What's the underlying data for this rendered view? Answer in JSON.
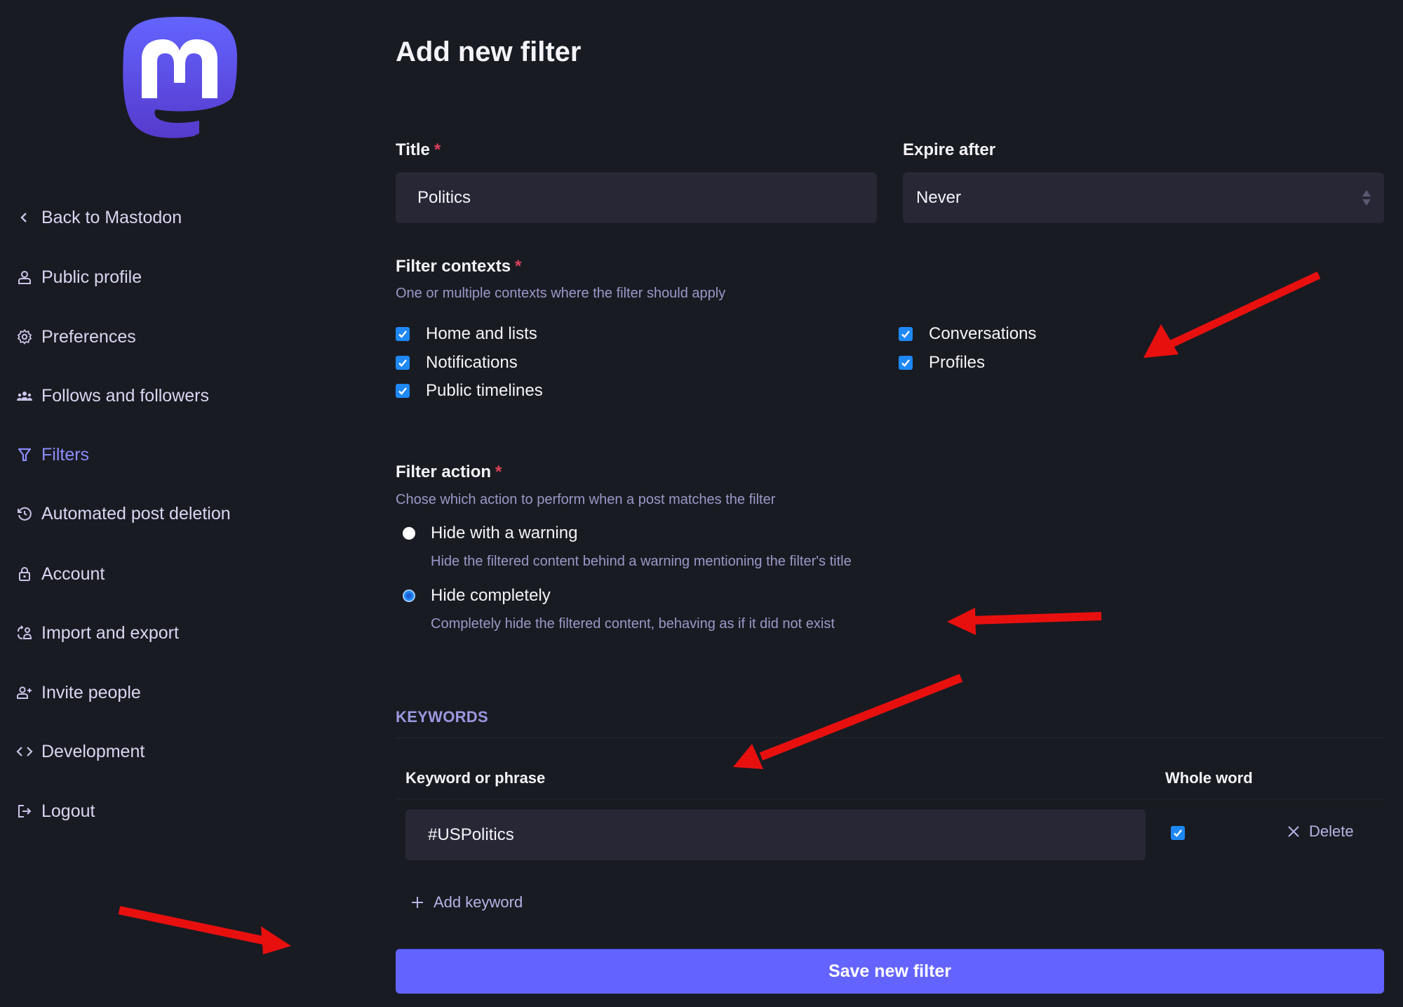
{
  "sidebar": {
    "logo": "mastodon-logo",
    "items": [
      {
        "label": "Back to Mastodon",
        "icon": "chevron-left-icon",
        "active": false
      },
      {
        "label": "Public profile",
        "icon": "user-icon",
        "active": false
      },
      {
        "label": "Preferences",
        "icon": "gear-icon",
        "active": false
      },
      {
        "label": "Follows and followers",
        "icon": "users-icon",
        "active": false
      },
      {
        "label": "Filters",
        "icon": "filter-icon",
        "active": true
      },
      {
        "label": "Automated post deletion",
        "icon": "history-icon",
        "active": false
      },
      {
        "label": "Account",
        "icon": "lock-icon",
        "active": false
      },
      {
        "label": "Import and export",
        "icon": "import-export-icon",
        "active": false
      },
      {
        "label": "Invite people",
        "icon": "user-plus-icon",
        "active": false
      },
      {
        "label": "Development",
        "icon": "code-icon",
        "active": false
      },
      {
        "label": "Logout",
        "icon": "logout-icon",
        "active": false
      }
    ]
  },
  "main": {
    "title": "Add new filter",
    "title_field": {
      "label": "Title",
      "required_mark": "*",
      "value": "Politics"
    },
    "expire_field": {
      "label": "Expire after",
      "value": "Never"
    },
    "contexts": {
      "label": "Filter contexts",
      "required_mark": "*",
      "hint": "One or multiple contexts where the filter should apply",
      "options": [
        {
          "label": "Home and lists",
          "checked": true
        },
        {
          "label": "Notifications",
          "checked": true
        },
        {
          "label": "Public timelines",
          "checked": true
        },
        {
          "label": "Conversations",
          "checked": true
        },
        {
          "label": "Profiles",
          "checked": true
        }
      ]
    },
    "action": {
      "label": "Filter action",
      "required_mark": "*",
      "hint": "Chose which action to perform when a post matches the filter",
      "options": [
        {
          "label": "Hide with a warning",
          "hint": "Hide the filtered content behind a warning mentioning the filter's title",
          "selected": false
        },
        {
          "label": "Hide completely",
          "hint": "Completely hide the filtered content, behaving as if it did not exist",
          "selected": true
        }
      ]
    },
    "keywords": {
      "heading": "KEYWORDS",
      "col_keyword": "Keyword or phrase",
      "col_whole_word": "Whole word",
      "rows": [
        {
          "keyword": "#USPolitics",
          "whole_word": true,
          "delete_label": "Delete"
        }
      ],
      "add_label": "Add keyword"
    },
    "save_label": "Save new filter"
  },
  "colors": {
    "background": "#191b22",
    "accent": "#6364ff",
    "active_nav": "#8c8dff",
    "checkbox": "#1e88f5",
    "required": "#df405a",
    "annotation_arrow": "#e8100f"
  },
  "annotations": [
    "red-arrow-contexts",
    "red-arrow-hide-completely",
    "red-arrow-keyword",
    "red-arrow-save"
  ]
}
